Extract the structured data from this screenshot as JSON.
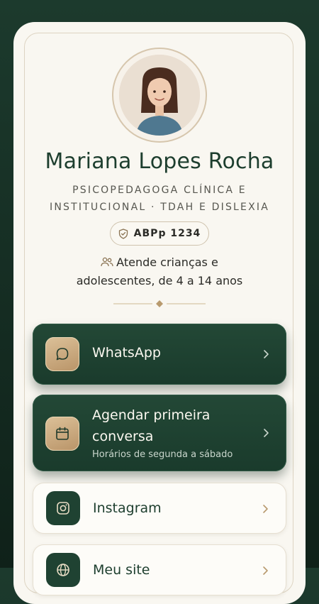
{
  "profile": {
    "name": "Mariana Lopes Rocha",
    "role_line1": "PSICOPEDAGOGA CLÍNICA E",
    "role_line2": "INSTITUCIONAL · TDAH E DISLEXIA",
    "badge": "ABPp 1234",
    "audience_line1": "Atende crianças e",
    "audience_line2": "adolescentes, de 4 a 14 anos"
  },
  "links": [
    {
      "label": "WhatsApp",
      "icon": "chat-bubble-icon",
      "style": "dark"
    },
    {
      "label_line1": "Agendar primeira",
      "label_line2": "conversa",
      "subtitle": "Horários de segunda a sábado",
      "icon": "calendar-icon",
      "style": "dark"
    },
    {
      "label": "Instagram",
      "icon": "instagram-icon",
      "style": "light"
    },
    {
      "label": "Meu site",
      "icon": "globe-icon",
      "style": "light"
    }
  ],
  "colors": {
    "background": "#14291f",
    "card": "#f9f7f1",
    "dark_button": "#1f4232",
    "gold_icon": "#c9a87c",
    "name_text": "#1d3e2e"
  }
}
